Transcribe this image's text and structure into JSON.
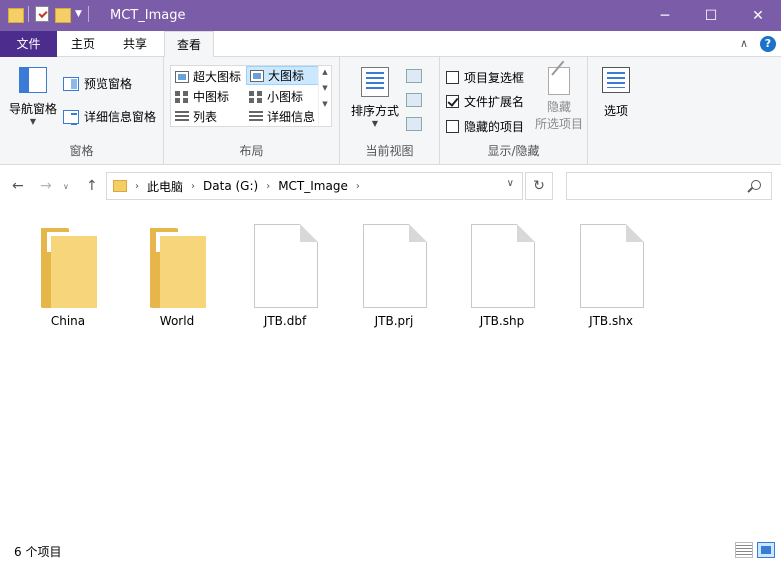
{
  "window": {
    "title": "MCT_Image",
    "min_glyph": "─",
    "max_glyph": "☐",
    "close_glyph": "✕",
    "title_bar_color": "#7b5ca9"
  },
  "ribbon": {
    "tabs": {
      "file": "文件",
      "home": "主页",
      "share": "共享",
      "view": "查看"
    },
    "pane_group": {
      "label": "窗格",
      "nav_pane": "导航窗格",
      "preview_pane": "预览窗格",
      "details_pane": "详细信息窗格"
    },
    "layout_group": {
      "label": "布局",
      "extra_large": "超大图标",
      "large": "大图标",
      "medium": "中图标",
      "small": "小图标",
      "list": "列表",
      "details": "详细信息",
      "selected": "大图标"
    },
    "current_view_group": {
      "label": "当前视图",
      "sort_by": "排序方式"
    },
    "show_hide_group": {
      "label": "显示/隐藏",
      "item_checkboxes": "项目复选框",
      "file_extensions": "文件扩展名",
      "hidden_items": "隐藏的项目",
      "hide_selected_1": "隐藏",
      "hide_selected_2": "所选项目",
      "item_checkboxes_checked": false,
      "file_extensions_checked": true,
      "hidden_items_checked": false
    },
    "options_group": {
      "options": "选项"
    }
  },
  "navigation": {
    "breadcrumb": [
      "此电脑",
      "Data (G:)",
      "MCT_Image"
    ],
    "search_placeholder": ""
  },
  "items": [
    {
      "name": "China",
      "type": "folder"
    },
    {
      "name": "World",
      "type": "folder"
    },
    {
      "name": "JTB.dbf",
      "type": "file"
    },
    {
      "name": "JTB.prj",
      "type": "file"
    },
    {
      "name": "JTB.shp",
      "type": "file"
    },
    {
      "name": "JTB.shx",
      "type": "file"
    }
  ],
  "status": {
    "count_text": "6 个项目"
  }
}
